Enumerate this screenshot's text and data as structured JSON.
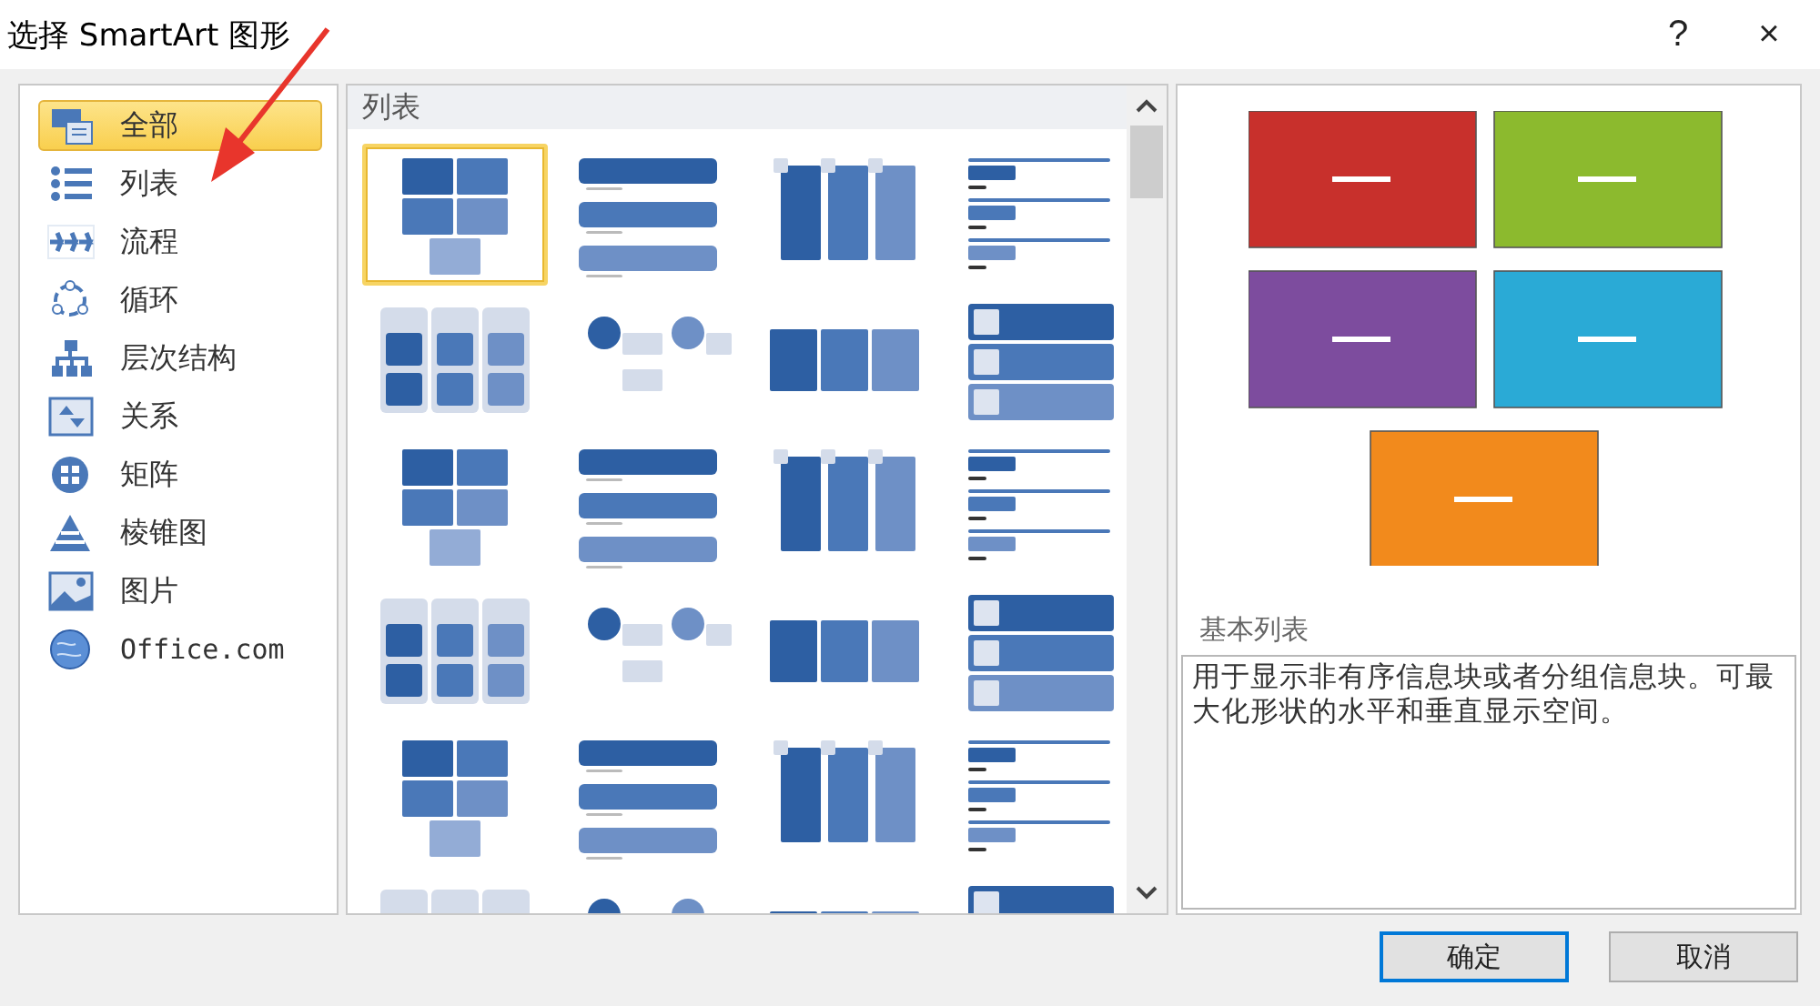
{
  "window": {
    "title": "选择 SmartArt 图形",
    "help": "?",
    "close": "×"
  },
  "categories": [
    {
      "label": "全部",
      "selected": true
    },
    {
      "label": "列表",
      "selected": false
    },
    {
      "label": "流程",
      "selected": false
    },
    {
      "label": "循环",
      "selected": false
    },
    {
      "label": "层次结构",
      "selected": false
    },
    {
      "label": "关系",
      "selected": false
    },
    {
      "label": "矩阵",
      "selected": false
    },
    {
      "label": "棱锥图",
      "selected": false
    },
    {
      "label": "图片",
      "selected": false
    },
    {
      "label": "Office.com",
      "selected": false
    }
  ],
  "gallery": {
    "heading": "列表",
    "items": [
      {
        "selected": true
      },
      {
        "selected": false
      },
      {
        "selected": false
      },
      {
        "selected": false
      },
      {
        "selected": false
      },
      {
        "selected": false
      },
      {
        "selected": false
      },
      {
        "selected": false
      },
      {
        "selected": false
      },
      {
        "selected": false
      },
      {
        "selected": false
      },
      {
        "selected": false
      },
      {
        "selected": false
      },
      {
        "selected": false
      },
      {
        "selected": false
      },
      {
        "selected": false
      },
      {
        "selected": false
      },
      {
        "selected": false
      },
      {
        "selected": false
      },
      {
        "selected": false
      },
      {
        "selected": false
      },
      {
        "selected": false
      },
      {
        "selected": false
      },
      {
        "selected": false
      }
    ]
  },
  "preview": {
    "shapes": [
      {
        "color": "#c8302c"
      },
      {
        "color": "#8cba2e"
      },
      {
        "color": "#7d4c9e"
      },
      {
        "color": "#2aaad6"
      },
      {
        "color": "#f28a1c"
      }
    ],
    "name": "基本列表",
    "description": "用于显示非有序信息块或者分组信息块。可最大化形状的水平和垂直显示空间。"
  },
  "buttons": [
    {
      "label": "确定",
      "default": true
    },
    {
      "label": "取消",
      "default": false
    }
  ]
}
